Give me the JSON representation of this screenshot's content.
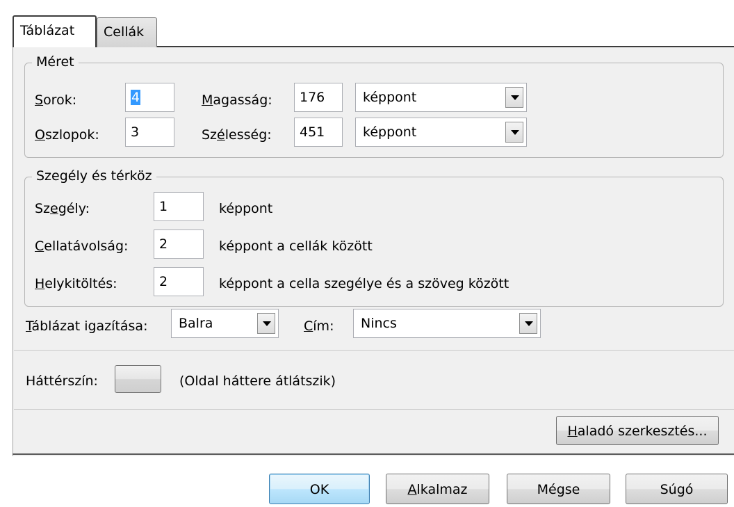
{
  "tabs": [
    {
      "label": "Táblázat",
      "active": true
    },
    {
      "label": "Cellák",
      "active": false
    }
  ],
  "size_group": {
    "legend": "Méret",
    "rows_label": {
      "mnemonic": "S",
      "rest": "orok:"
    },
    "rows_value": "4",
    "cols_label": {
      "mnemonic": "O",
      "rest": "szlopok:"
    },
    "cols_value": "3",
    "height_label": {
      "mnemonic": "M",
      "rest": "agasság:"
    },
    "height_value": "176",
    "height_unit": "képpont",
    "width_label": {
      "pre": "Sz",
      "mnemonic": "é",
      "rest": "lesség:"
    },
    "width_value": "451",
    "width_unit": "képpont"
  },
  "border_group": {
    "legend": "Szegély és térköz",
    "border_label": {
      "pre": "Sz",
      "mnemonic": "e",
      "rest": "gély:"
    },
    "border_value": "1",
    "border_unit": "képpont",
    "spacing_label": {
      "mnemonic": "C",
      "rest": "ellatávolság:"
    },
    "spacing_value": "2",
    "spacing_unit": "képpont a cellák között",
    "padding_label": {
      "mnemonic": "H",
      "rest": "elykitöltés:"
    },
    "padding_value": "2",
    "padding_unit": "képpont a cella szegélye és a szöveg között"
  },
  "alignment": {
    "label": {
      "mnemonic": "T",
      "rest": "áblázat igazítása:"
    },
    "value": "Balra",
    "caption_label": {
      "mnemonic": "C",
      "rest": "ím:"
    },
    "caption_value": "Nincs"
  },
  "background": {
    "label": "Háttérszín:",
    "note": "(Oldal háttere átlátszik)"
  },
  "advanced_button": {
    "mnemonic": "H",
    "rest": "aladó szerkesztés..."
  },
  "buttons": {
    "ok": "OK",
    "apply": {
      "mnemonic": "A",
      "rest": "lkalmaz"
    },
    "cancel": "Mégse",
    "help": "Súgó"
  },
  "colors": {
    "selection": "#3399ff",
    "panel": "#f0f0f0",
    "default_button": "#bee6fd"
  }
}
